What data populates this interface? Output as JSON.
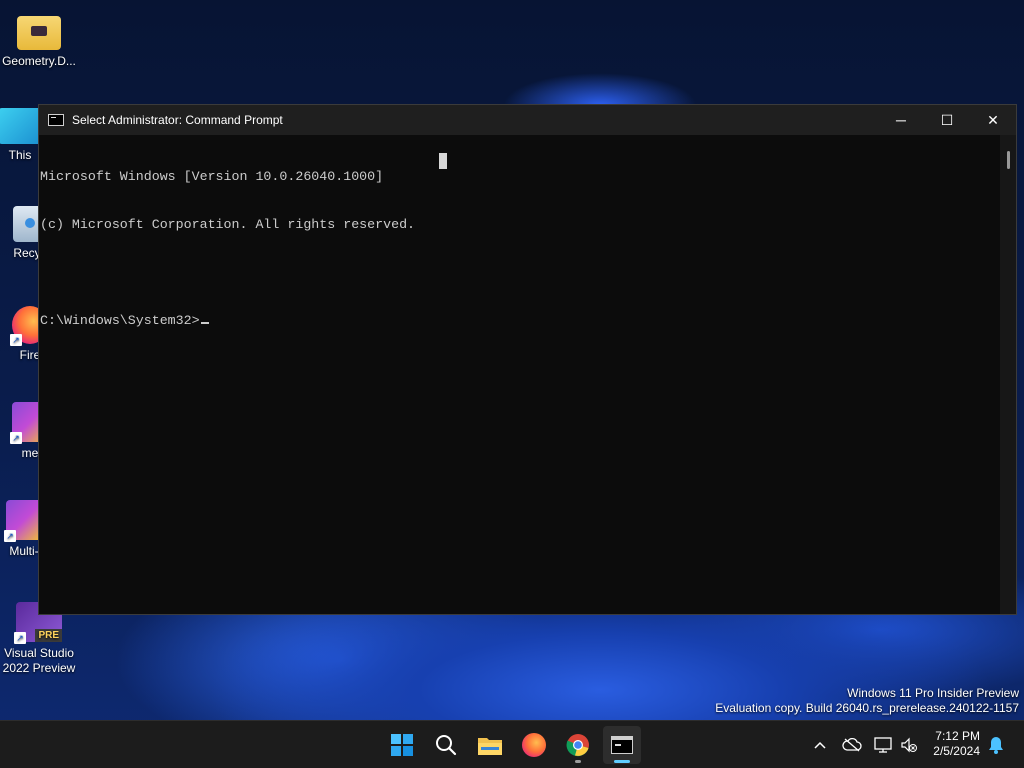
{
  "desktop": {
    "icons": [
      {
        "label": "Geometry.D...",
        "icon": "folder-icon"
      },
      {
        "label": "This",
        "icon": "this-pc-icon"
      },
      {
        "label": "Recyc",
        "icon": "recycle-bin-icon"
      },
      {
        "label": "Fire",
        "icon": "firefox-icon"
      },
      {
        "label": "me",
        "icon": "app-shortcut-icon"
      },
      {
        "label": "Multi-",
        "icon": "app-shortcut-icon"
      },
      {
        "label": "Visual Studio 2022 Preview",
        "icon": "visual-studio-icon",
        "badge": "PRE"
      }
    ]
  },
  "window": {
    "title": "Select Administrator: Command Prompt",
    "controls": {
      "minimize": "─",
      "maximize": "☐",
      "close": "✕"
    },
    "console": {
      "lines": [
        "Microsoft Windows [Version 10.0.26040.1000]",
        "(c) Microsoft Corporation. All rights reserved.",
        "",
        "C:\\Windows\\System32>"
      ]
    }
  },
  "watermark": {
    "line1": "Windows 11 Pro Insider Preview",
    "line2": "Evaluation copy. Build 26040.rs_prerelease.240122-1157"
  },
  "taskbar": {
    "items": [
      {
        "name": "start",
        "icon": "windows-start-icon"
      },
      {
        "name": "search",
        "icon": "search-icon"
      },
      {
        "name": "file-explorer",
        "icon": "folder-icon"
      },
      {
        "name": "firefox",
        "icon": "firefox-icon"
      },
      {
        "name": "chrome",
        "icon": "chrome-icon"
      },
      {
        "name": "command-prompt",
        "icon": "terminal-icon",
        "active": true
      }
    ],
    "tray": {
      "time": "7:12 PM",
      "date": "2/5/2024"
    }
  },
  "colors": {
    "accent": "#60cdff",
    "console_bg": "#0c0c0c",
    "console_text": "#cccccc",
    "titlebar": "#1f1f1f"
  }
}
